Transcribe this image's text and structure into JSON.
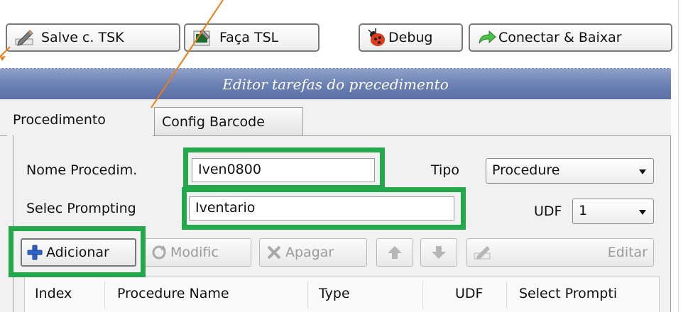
{
  "toolbar": {
    "save_tsk_label": "Salve c. TSK",
    "make_tsl_label": "Faça TSL",
    "debug_label": "Debug",
    "connect_label": "Conectar & Baixar"
  },
  "editor": {
    "title": "Editor tarefas do precedimento",
    "tabs": [
      "Procedimento",
      "Config Barcode"
    ]
  },
  "form": {
    "name_label": "Nome Procedim.",
    "name_value": "Iven0800",
    "type_label": "Tipo",
    "type_value": "Procedure",
    "prompt_label": "Selec Prompting",
    "prompt_value": "Iventario",
    "udf_label": "UDF",
    "udf_value": "1"
  },
  "actions": {
    "add": "Adicionar",
    "modify": "Modific",
    "delete": "Apagar",
    "edit": "Editar"
  },
  "table": {
    "columns": [
      "Index",
      "Procedure Name",
      "Type",
      "UDF",
      "Select Prompti"
    ]
  },
  "colors": {
    "highlight_box": "#24a84c",
    "annotation_arrow": "#f07c12",
    "title_bar": "#6a7fb2"
  }
}
